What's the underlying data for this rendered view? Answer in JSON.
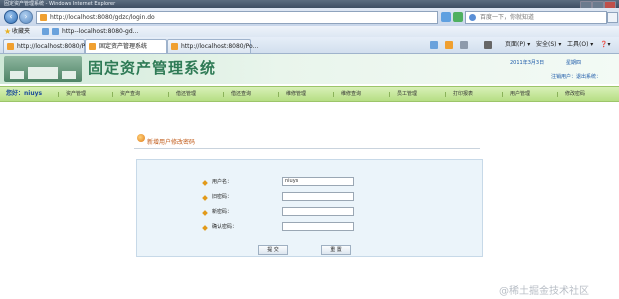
{
  "browser": {
    "window_title": "固定资产管理系统 - Windows Internet Explorer",
    "address": "http://localhost:8080/gdzc/login.do",
    "search_placeholder": "百度一下，你就知道",
    "favorites_label": "收藏夹",
    "favorites_link": "http--localhost:8080-gd...",
    "tabs": [
      {
        "label": "http://localhost:8080/Po..."
      },
      {
        "label": "固定资产管理系统"
      },
      {
        "label": "http://localhost:8080/Po..."
      }
    ],
    "commands": {
      "page": "页面(P) ▾",
      "safety": "安全(S) ▾",
      "tools": "工具(O) ▾",
      "help": "❓▾"
    }
  },
  "site": {
    "title": "固定资产管理系统",
    "date": "2011年3月3日",
    "weekday": "星期四",
    "user_line": "注销用户：退出系统：",
    "greeting": "您好：niuys",
    "menu": [
      "资产管理",
      "资产查询",
      "借还管理",
      "借还查询",
      "维修管理",
      "维修查询",
      "员工管理",
      "打印报表",
      "用户管理",
      "修改密码"
    ]
  },
  "form": {
    "title": "新增用户修改密码",
    "fields": [
      {
        "label": "用户名：",
        "value": "niuys"
      },
      {
        "label": "旧密码：",
        "value": ""
      },
      {
        "label": "新密码：",
        "value": ""
      },
      {
        "label": "确认密码：",
        "value": ""
      }
    ],
    "submit_label": "提 交",
    "reset_label": "重 置"
  },
  "watermark": "@稀土掘金技术社区",
  "colors": {
    "accent_green": "#2e7a55",
    "menu_green": "#b6de84",
    "link_blue": "#1a58a8",
    "form_bg": "#ebf4fa"
  }
}
